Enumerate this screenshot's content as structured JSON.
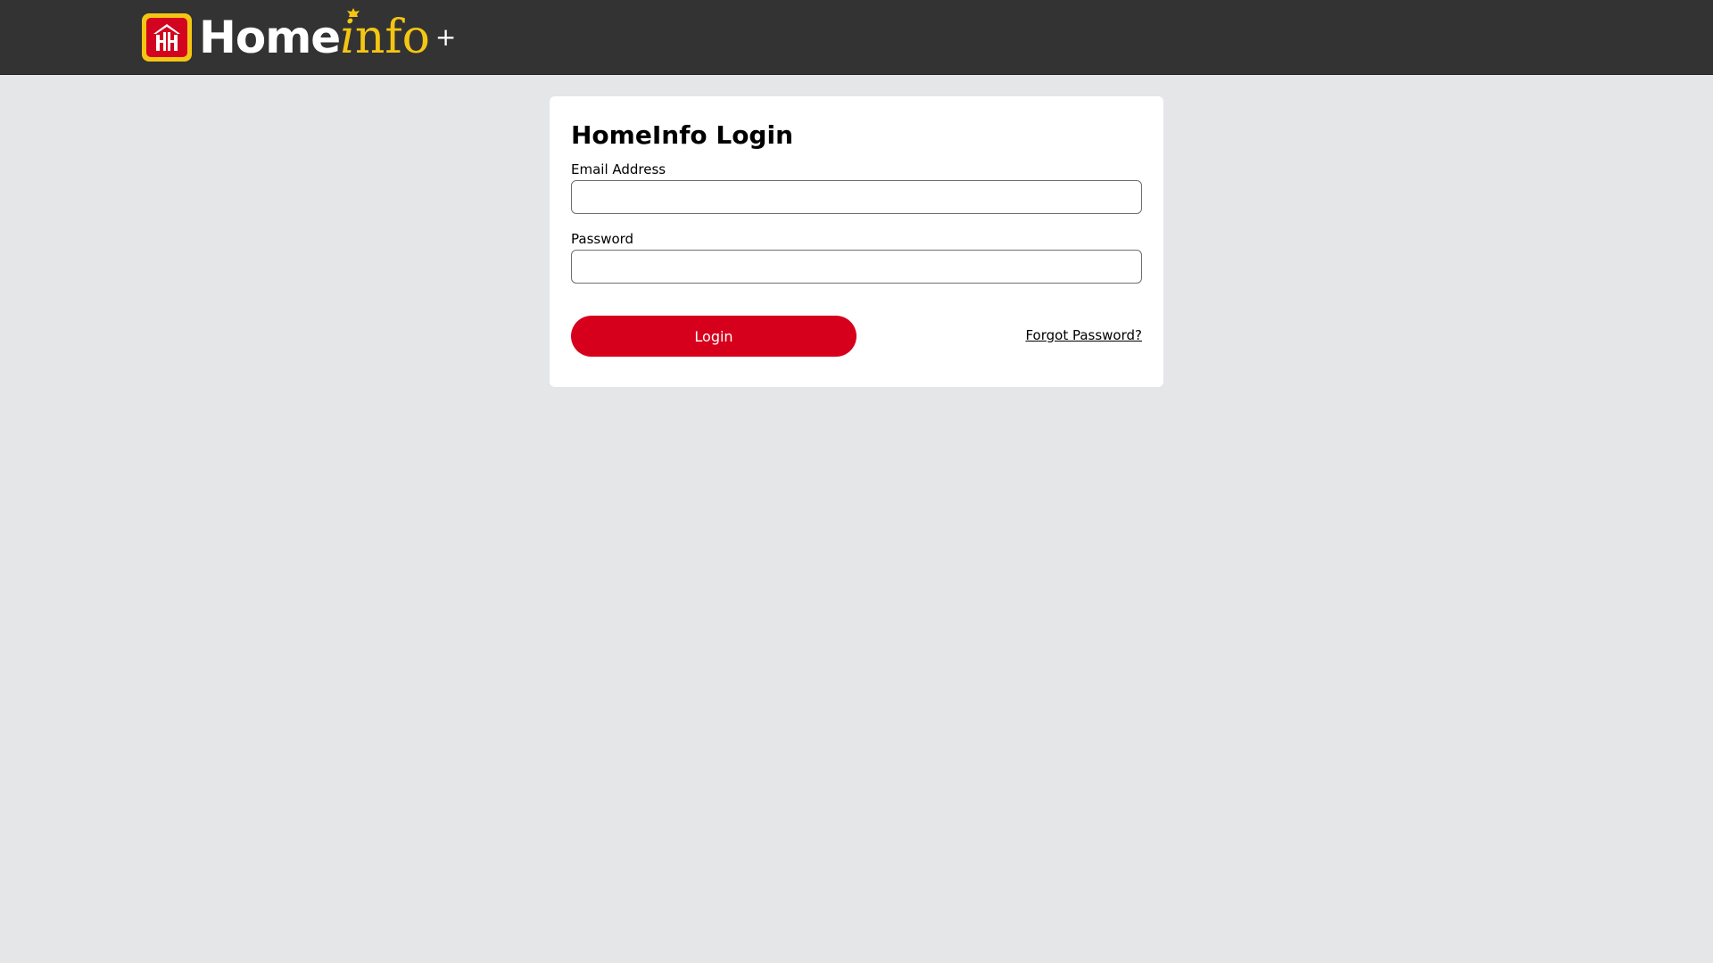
{
  "header": {
    "logo": {
      "word_home": "Home",
      "word_i": "i",
      "word_nfo": "nfo",
      "plus": "+",
      "badge_icon": "home-hardware-badge-icon",
      "colors": {
        "bar": "#333333",
        "badge_outer": "#f4c614",
        "badge_inner": "#d3041f",
        "info_text": "#f4c614"
      }
    }
  },
  "login_card": {
    "title": "HomeInfo Login",
    "email": {
      "label": "Email Address",
      "value": "",
      "placeholder": ""
    },
    "password": {
      "label": "Password",
      "value": "",
      "placeholder": ""
    },
    "login_button_label": "Login",
    "forgot_password_label": "Forgot Password?",
    "colors": {
      "primary_button": "#d6001c",
      "page_background": "#e5e6e8"
    }
  }
}
